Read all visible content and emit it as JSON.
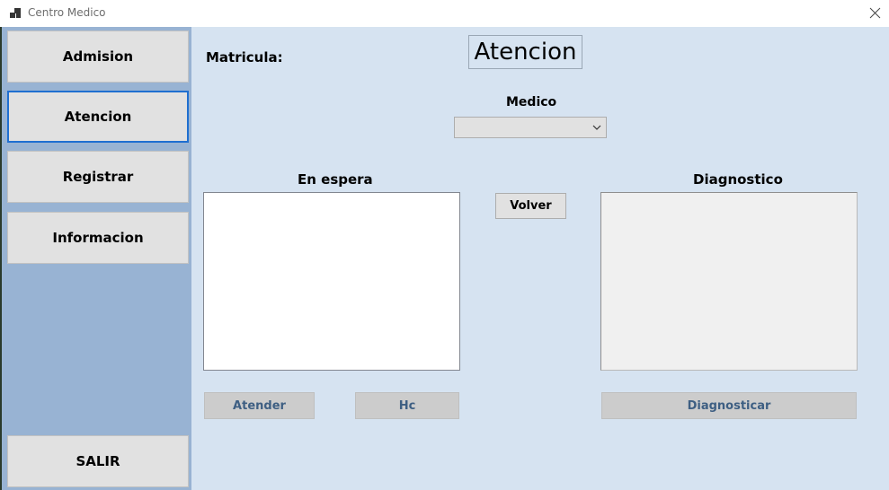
{
  "window": {
    "title": "Centro Medico",
    "icon": "app-windows-icon",
    "close_icon": "close-icon"
  },
  "sidebar": {
    "items": [
      {
        "label": "Admision",
        "active": false
      },
      {
        "label": "Atencion",
        "active": true
      },
      {
        "label": "Registrar",
        "active": false
      },
      {
        "label": "Informacion",
        "active": false
      }
    ],
    "exit_label": "SALIR"
  },
  "main": {
    "matricula_label": "Matricula:",
    "heading": "Atencion",
    "medico_label": "Medico",
    "medico_value": "",
    "waiting_label": "En espera",
    "diagnosis_label": "Diagnostico",
    "back_button": "Volver",
    "attend_button": "Atender",
    "hc_button": "Hc",
    "diagnose_button": "Diagnosticar"
  },
  "colors": {
    "sidebar_bg": "#98b3d3",
    "main_bg": "#d6e3f1",
    "active_border": "#1f6fd0",
    "disabled_text": "#3e5f83"
  }
}
